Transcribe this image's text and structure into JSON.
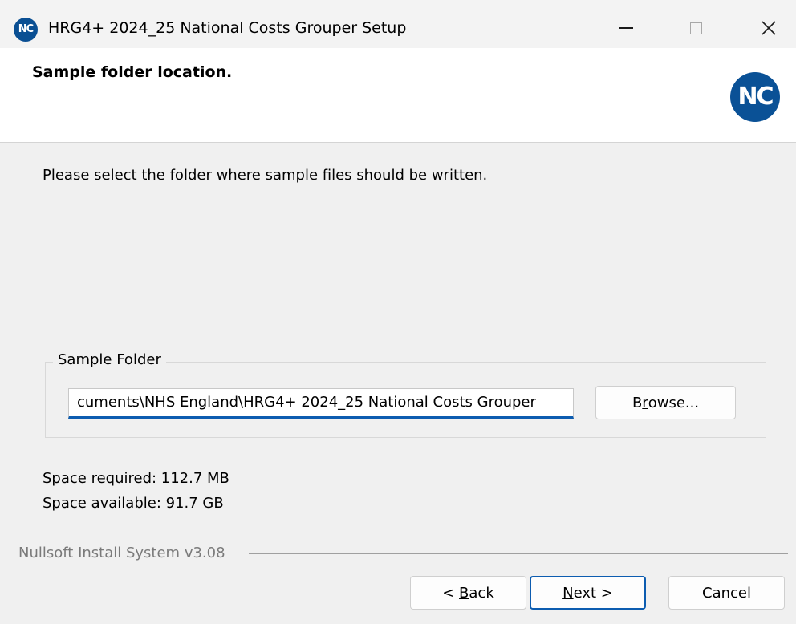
{
  "window": {
    "title": "HRG4+ 2024_25 National Costs Grouper Setup",
    "icon": "nc-app-icon",
    "icon_text": "NC"
  },
  "header": {
    "title": "Sample folder location.",
    "logo_text": "NC"
  },
  "main": {
    "instruction": "Please select the folder where sample files should be written.",
    "group_label": "Sample Folder",
    "folder_value": "cuments\\NHS England\\HRG4+ 2024_25 National Costs Grouper",
    "browse_pre": "B",
    "browse_accel": "r",
    "browse_post": "owse...",
    "space_required": "Space required: 112.7 MB",
    "space_available": "Space available: 91.7 GB"
  },
  "footer": {
    "brand": "Nullsoft Install System v3.08",
    "back_pre": "< ",
    "back_accel": "B",
    "back_post": "ack",
    "next_accel": "N",
    "next_post": "ext >",
    "cancel_label": "Cancel"
  },
  "colors": {
    "accent": "#0c5cb0",
    "logo": "#0a5196"
  }
}
